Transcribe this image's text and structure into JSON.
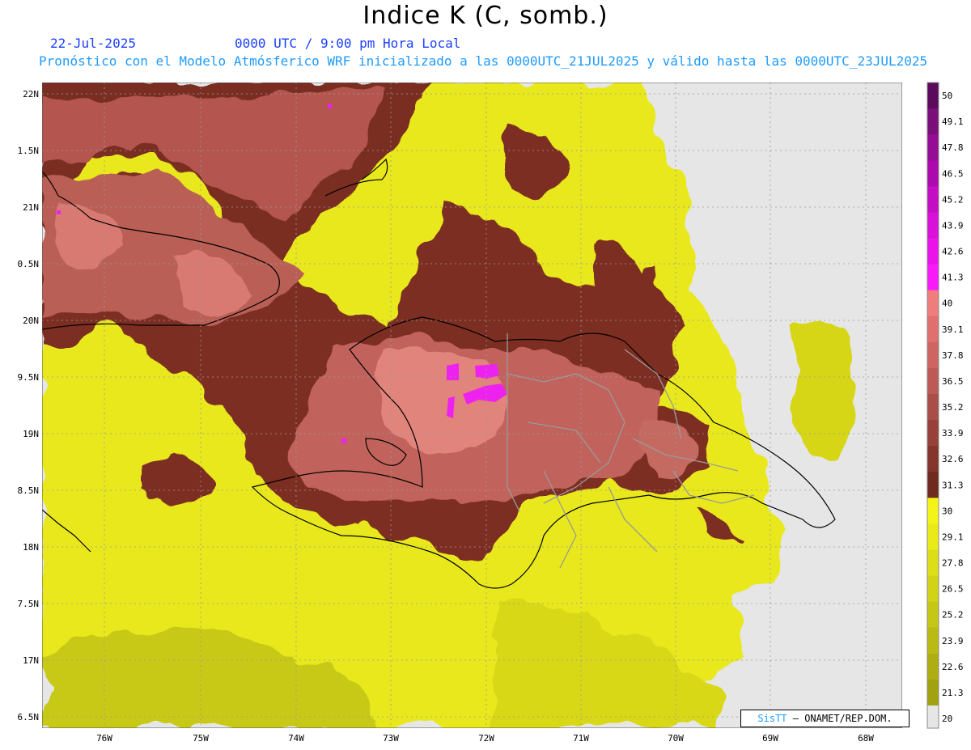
{
  "header": {
    "title": "Indice K (C, somb.)",
    "date": "22-Jul-2025",
    "time": "0000 UTC / 9:00 pm Hora Local",
    "description": "Pronóstico con el Modelo Atmósferico WRF inicializado a las 0000UTC_21JUL2025 y válido hasta las  0000UTC_23JUL2025"
  },
  "axes": {
    "lat_labels": [
      "22N",
      "1.5N",
      "21N",
      "0.5N",
      "20N",
      "9.5N",
      "19N",
      "8.5N",
      "18N",
      "7.5N",
      "17N",
      "6.5N"
    ],
    "lon_labels": [
      "76W",
      "75W",
      "74W",
      "73W",
      "72W",
      "71W",
      "70W",
      "69W",
      "68W"
    ]
  },
  "colorbar": {
    "levels": [
      "50",
      "49.1",
      "47.8",
      "46.5",
      "45.2",
      "43.9",
      "42.6",
      "41.3",
      "40",
      "39.1",
      "37.8",
      "36.5",
      "35.2",
      "33.9",
      "32.6",
      "31.3",
      "30",
      "29.1",
      "27.8",
      "26.5",
      "25.2",
      "23.9",
      "22.6",
      "21.3",
      "20"
    ],
    "colors": [
      "#5c0a5c",
      "#7a0f7a",
      "#940d94",
      "#ad0aad",
      "#c40cc4",
      "#d810d8",
      "#ea14ea",
      "#f81af8",
      "#f07d7d",
      "#e0706d",
      "#cf6562",
      "#bd5a55",
      "#aa4e48",
      "#97413a",
      "#83352c",
      "#6e2a1e",
      "#f4f41a",
      "#eaea19",
      "#dede18",
      "#d2d216",
      "#c6c615",
      "#baba13",
      "#aeae12",
      "#a2a210"
    ],
    "below_color": "#e6e6e6",
    "accent_text_color": "#1e40ff"
  },
  "credit": {
    "brand": "SisTT",
    "text": " – ONAMET/REP.DOM."
  }
}
